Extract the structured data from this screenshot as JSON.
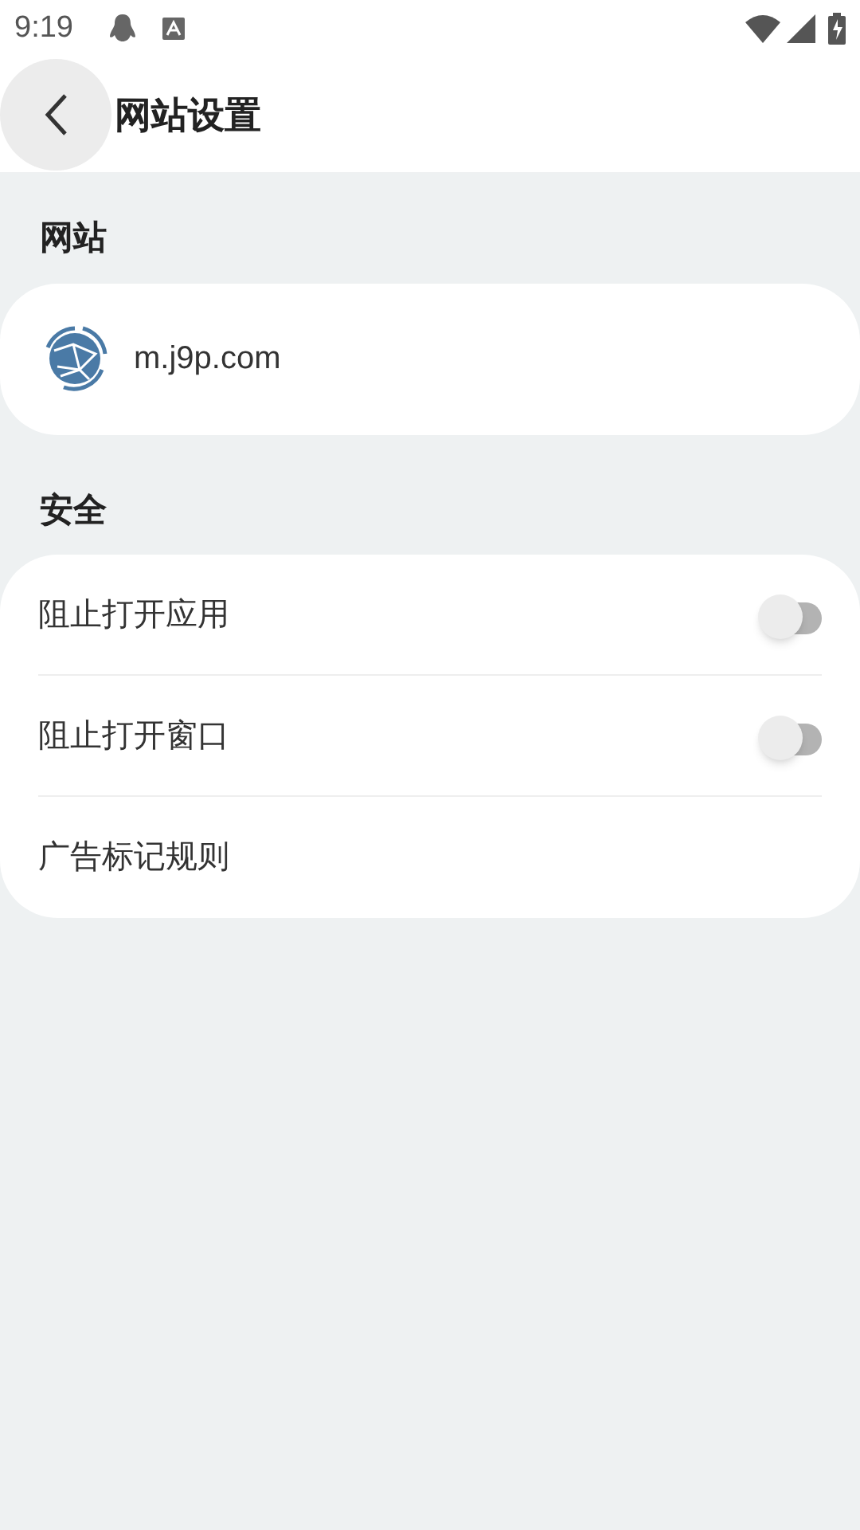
{
  "status_bar": {
    "time": "9:19"
  },
  "header": {
    "title": "网站设置"
  },
  "site_section": {
    "title": "网站",
    "site": "m.j9p.com"
  },
  "security_section": {
    "title": "安全",
    "items": [
      {
        "kind": "toggle",
        "label": "阻止打开应用",
        "on": false
      },
      {
        "kind": "toggle",
        "label": "阻止打开窗口",
        "on": false
      },
      {
        "kind": "link",
        "label": "广告标记规则"
      }
    ]
  }
}
